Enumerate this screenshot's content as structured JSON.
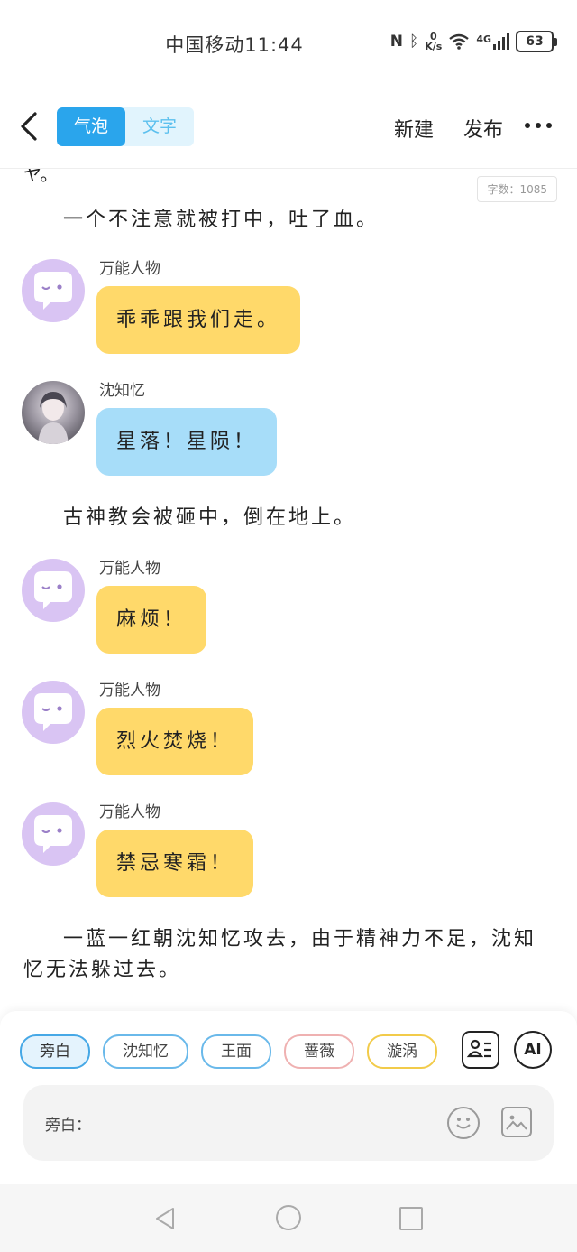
{
  "status_bar": {
    "time": "中国移动11:44",
    "net_speed_value": "0",
    "net_speed_unit": "K/s",
    "network": "4G",
    "battery": "63"
  },
  "header": {
    "tabs": [
      {
        "label": "气泡",
        "active": true
      },
      {
        "label": "文字",
        "active": false
      }
    ],
    "new_label": "新建",
    "publish_label": "发布"
  },
  "chat": {
    "word_count": "字数：1085",
    "cut_text": "ヤ。",
    "items": [
      {
        "type": "narration",
        "text": "一个不注意就被打中，吐了血。"
      },
      {
        "type": "bubble",
        "speaker": "万能人物",
        "text": "乖乖跟我们走。",
        "color": "#ffd96a"
      },
      {
        "type": "bubble",
        "speaker": "沈知忆",
        "text": "星落！星陨！",
        "color": "#a7ddf9"
      },
      {
        "type": "narration",
        "text": "古神教会被砸中，倒在地上。"
      },
      {
        "type": "bubble",
        "speaker": "万能人物",
        "text": "麻烦！",
        "color": "#ffd96a"
      },
      {
        "type": "bubble",
        "speaker": "万能人物",
        "text": "烈火焚烧！",
        "color": "#ffd96a"
      },
      {
        "type": "bubble",
        "speaker": "万能人物",
        "text": "禁忌寒霜！",
        "color": "#ffd96a"
      },
      {
        "type": "narration",
        "text": "一蓝一红朝沈知忆攻去，由于精神力不足，沈知忆无法躲过去。"
      }
    ]
  },
  "composer": {
    "roles": [
      "旁白",
      "沈知忆",
      "王面",
      "蔷薇",
      "漩涡"
    ],
    "selected_role": "旁白",
    "ai_label": "AI",
    "input_label": "旁白：",
    "input_value": "",
    "input_placeholder": ""
  },
  "colors": {
    "accent": "#2aa5ec",
    "bubble_yellow": "#ffd96a",
    "bubble_blue": "#a7ddf9",
    "avatar_purple": "#d9c4f3"
  }
}
